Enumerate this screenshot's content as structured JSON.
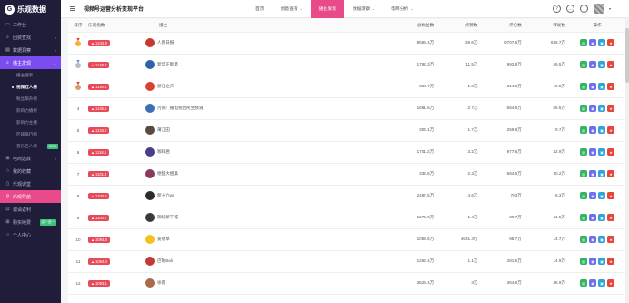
{
  "app": {
    "logo_letter": "G",
    "logo_text": "乐观数据",
    "title": "视频号运营分析变现平台"
  },
  "sidebar": {
    "items": [
      {
        "label": "工作台",
        "icon": "monitor-icon"
      },
      {
        "label": "团费查找",
        "icon": "search-icon",
        "caret": "›"
      },
      {
        "label": "数据洞察",
        "icon": "chart-icon",
        "caret": "›"
      },
      {
        "label": "播主发现",
        "icon": "search-icon",
        "caret": "⌄",
        "active": true
      }
    ],
    "sub_items": [
      {
        "label": "播主搜索"
      },
      {
        "label": "视频红人榜",
        "current": true
      },
      {
        "label": "粉丝飙升榜"
      },
      {
        "label": "影响力播榜"
      },
      {
        "label": "影响力主播"
      },
      {
        "label": "区域排行榜"
      },
      {
        "label": "音乐名人榜",
        "badge": "NEW"
      }
    ],
    "items2": [
      {
        "label": "电商选款",
        "icon": "cart-icon",
        "caret": "›"
      },
      {
        "label": "我的收藏",
        "icon": "star-icon"
      },
      {
        "label": "乐观课堂",
        "icon": "book-icon"
      },
      {
        "label": "乐观导航",
        "icon": "link-icon",
        "active_pink": true
      },
      {
        "label": "邀请返利",
        "icon": "gift-icon"
      },
      {
        "label": "购买续费",
        "icon": "cart-icon",
        "badge": "买一送一"
      },
      {
        "label": "个人中心",
        "icon": "user-icon"
      }
    ]
  },
  "topnav": {
    "items": [
      {
        "label": "首页"
      },
      {
        "label": "创意查看",
        "chev": "⌄"
      },
      {
        "label": "播主发现",
        "active": true
      },
      {
        "label": "数据洞察",
        "chev": "⌄"
      },
      {
        "label": "电商分析",
        "chev": "⌄"
      }
    ]
  },
  "table": {
    "headers": [
      "排序",
      "乐观指数",
      "播主",
      "总粉丝数",
      "点赞数",
      "评论数",
      "转发数",
      "操作"
    ],
    "rows": [
      {
        "rank": "",
        "medal": "gold",
        "score": "1242.8",
        "name": "人民日报",
        "avatar_color": "#c63a2e",
        "fans": "8586.4万",
        "likes": "39.6亿",
        "comments": "6707.6万",
        "shares": "635.7万"
      },
      {
        "rank": "",
        "medal": "silver",
        "score": "1148.3",
        "name": "新华正能量",
        "avatar_color": "#2f63a8",
        "fans": "1792.3万",
        "likes": "11.5亿",
        "comments": "992.8万",
        "shares": "59.5万"
      },
      {
        "rank": "",
        "medal": "bronze",
        "score": "1140.2",
        "name": "浙江之声",
        "avatar_color": "#d8402f",
        "fans": "368.7万",
        "likes": "1.8亿",
        "comments": "314.8万",
        "shares": "10.5万"
      },
      {
        "rank": "4",
        "medal": "",
        "score": "1135.1",
        "name": "河南广播电视台民生频道",
        "avatar_color": "#3b6fb0",
        "fans": "1661.6万",
        "likes": "2.7亿",
        "comments": "564.6万",
        "shares": "55.5万"
      },
      {
        "rank": "5",
        "medal": "",
        "score": "1133.2",
        "name": "莆江田",
        "avatar_color": "#5a4a40",
        "fans": "304.1万",
        "likes": "1.7亿",
        "comments": "259.9万",
        "shares": "9.7万"
      },
      {
        "rank": "6",
        "medal": "",
        "score": "1118.6",
        "name": "咖啡君",
        "avatar_color": "#4a3c8a",
        "fans": "1701.2万",
        "likes": "3.2亿",
        "comments": "977.6万",
        "shares": "42.9万"
      },
      {
        "rank": "7",
        "medal": "",
        "score": "1101.4",
        "name": "德甜大姐桑",
        "avatar_color": "#8a3a5e",
        "fans": "332.6万",
        "likes": "2.3亿",
        "comments": "564.5万",
        "shares": "30.2万"
      },
      {
        "rank": "8",
        "medal": "",
        "score": "1100.8",
        "name": "新十六wi",
        "avatar_color": "#2c2c2c",
        "fans": "2497.5万",
        "likes": "4.6亿",
        "comments": "793万",
        "shares": "6.3万"
      },
      {
        "rank": "9",
        "medal": "",
        "score": "1100.7",
        "name": "御秘新下城",
        "avatar_color": "#3a3a3a",
        "fans": "1276.6万",
        "likes": "1.4亿",
        "comments": "39.7万",
        "shares": "11.5万"
      },
      {
        "rank": "10",
        "medal": "",
        "score": "1094.8",
        "name": "爱德草",
        "avatar_color": "#f2c21b",
        "fans": "1059.6万",
        "likes": "4631.4万",
        "comments": "98.7万",
        "shares": "14.7万"
      },
      {
        "rank": "11",
        "medal": "",
        "score": "1094.4",
        "name": "巴啦Bali",
        "avatar_color": "#c23a3a",
        "fans": "1262.4万",
        "likes": "1.1亿",
        "comments": "281.5万",
        "shares": "14.9万"
      },
      {
        "rank": "12",
        "medal": "",
        "score": "1093.1",
        "name": "徐霞",
        "avatar_color": "#a86a4a",
        "fans": "3626.4万",
        "likes": "3亿",
        "comments": "364.6万",
        "shares": "46.9万"
      }
    ]
  },
  "colors": {
    "sidebar_bg": "#1f1d3a",
    "accent_purple": "#7b4df0",
    "accent_pink": "#e84a8a",
    "score_red": "#e84a5a"
  }
}
